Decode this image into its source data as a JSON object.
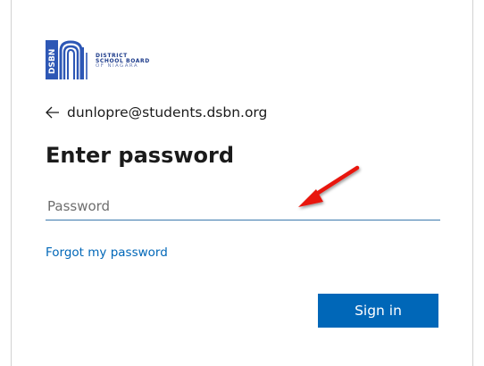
{
  "brand": {
    "abbr": "DSBN",
    "line1": "DISTRICT",
    "line2": "SCHOOL BOARD",
    "line3": "OF NIAGARA",
    "color": "#1b3a8a"
  },
  "account": {
    "back_icon": "arrow-left-icon",
    "email": "dunlopre@students.dsbn.org"
  },
  "title": "Enter password",
  "password_field": {
    "placeholder": "Password",
    "value": ""
  },
  "forgot_link": "Forgot my password",
  "signin_button": "Sign in",
  "colors": {
    "accent": "#0067b8",
    "input_underline": "#3c79ad",
    "annotation_arrow": "#e8120c"
  },
  "annotation": {
    "icon": "red-pointer-arrow-icon"
  }
}
